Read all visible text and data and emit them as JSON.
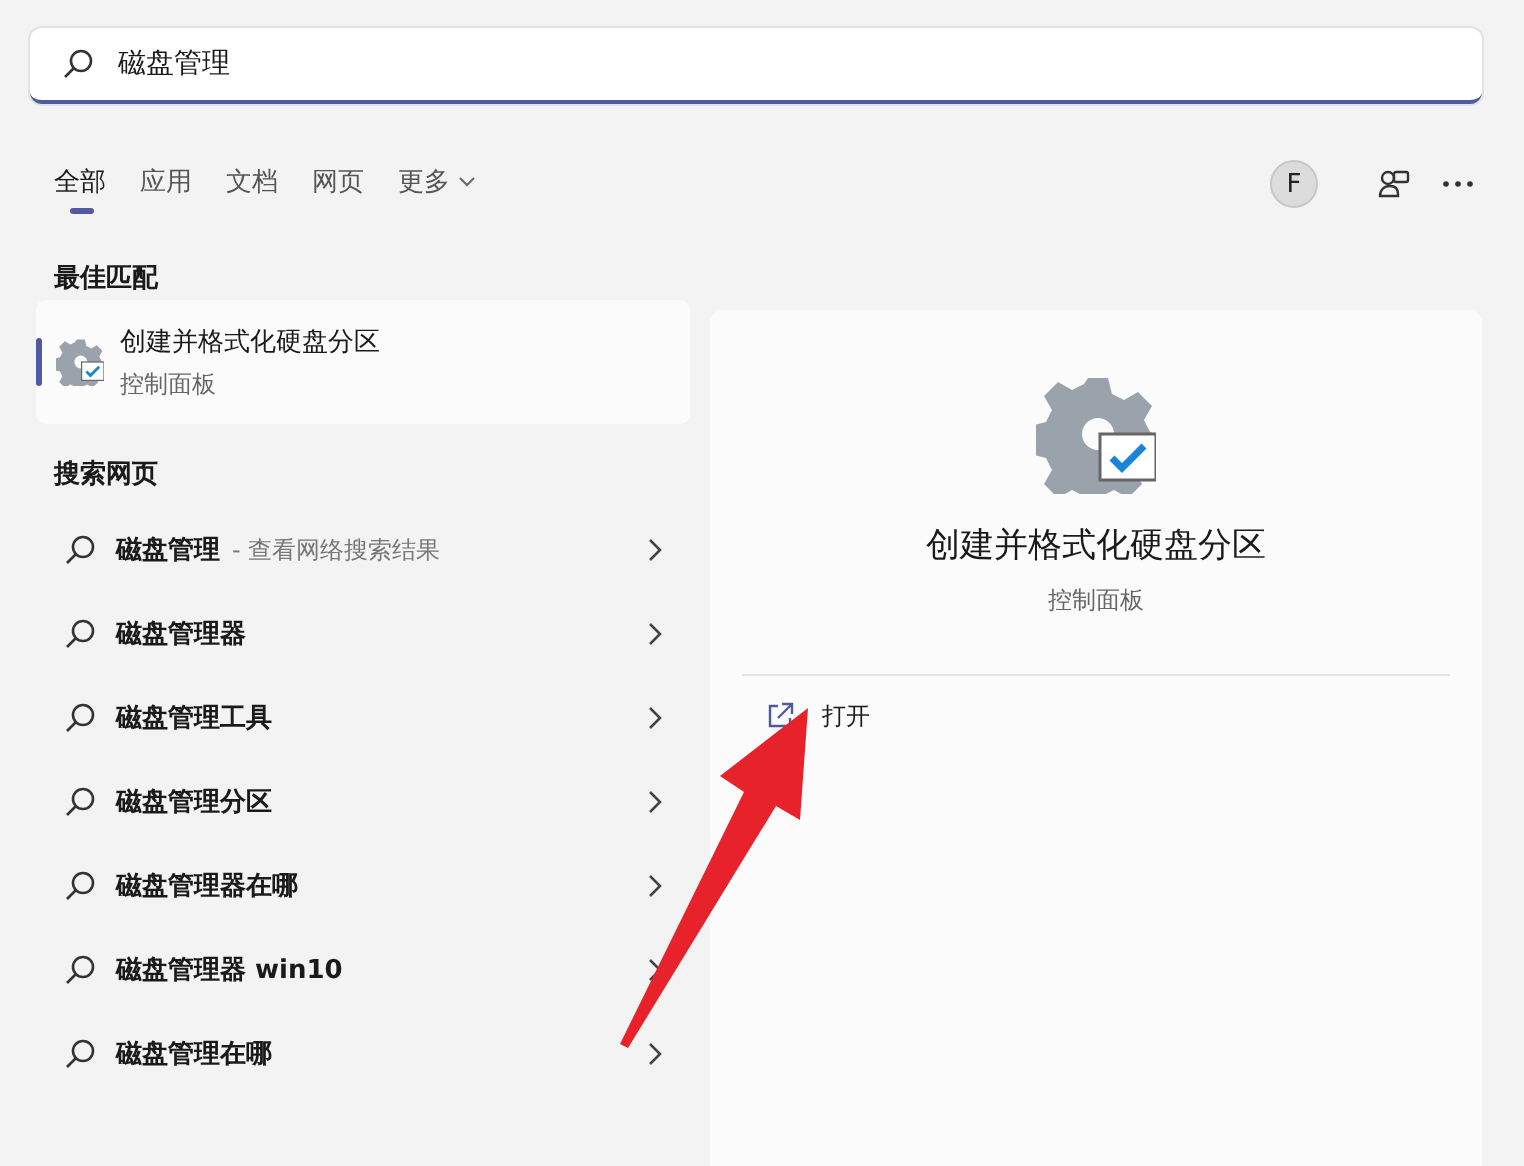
{
  "search": {
    "value": "磁盘管理"
  },
  "tabs": [
    {
      "label": "全部",
      "selected": true
    },
    {
      "label": "应用",
      "selected": false
    },
    {
      "label": "文档",
      "selected": false
    },
    {
      "label": "网页",
      "selected": false
    },
    {
      "label": "更多",
      "selected": false,
      "dropdown": true
    }
  ],
  "account": {
    "initial": "F"
  },
  "best_match": {
    "heading": "最佳匹配",
    "item": {
      "title": "创建并格式化硬盘分区",
      "subtitle": "控制面板",
      "selected": true
    }
  },
  "web": {
    "heading": "搜索网页",
    "items": [
      {
        "query": "磁盘管理",
        "suffix": "- 查看网络搜索结果"
      },
      {
        "query": "磁盘管理器"
      },
      {
        "query": "磁盘管理工具"
      },
      {
        "query": "磁盘管理分区"
      },
      {
        "query": "磁盘管理器在哪"
      },
      {
        "query": "磁盘管理器 win10"
      },
      {
        "query": "磁盘管理在哪"
      }
    ]
  },
  "preview": {
    "title": "创建并格式化硬盘分区",
    "subtitle": "控制面板",
    "actions": [
      {
        "label": "打开"
      }
    ]
  }
}
